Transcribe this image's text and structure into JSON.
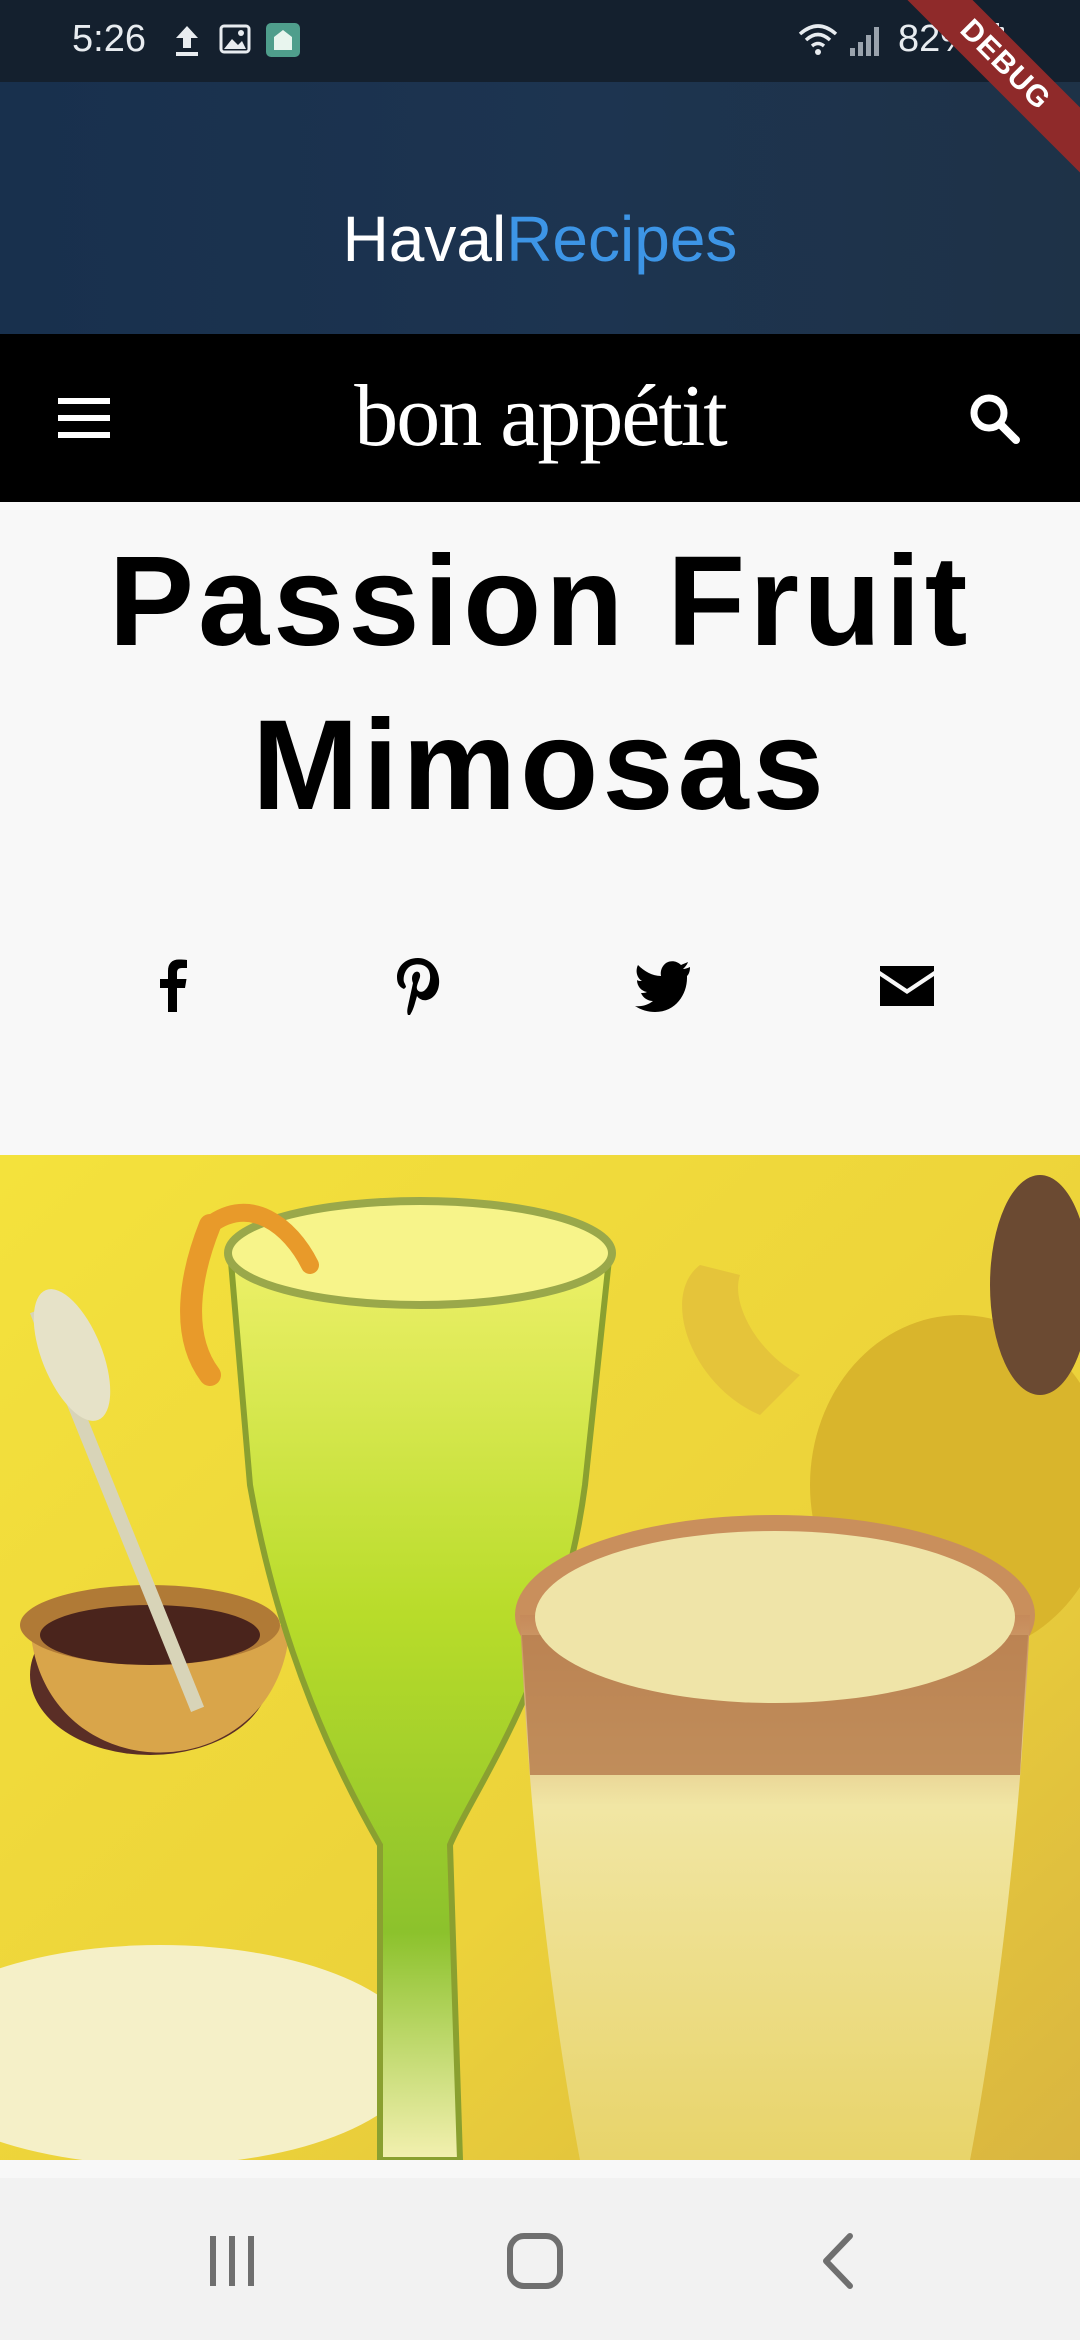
{
  "status_bar": {
    "time": "5:26",
    "battery": "82%"
  },
  "header": {
    "title_part1": "Haval",
    "title_part2": "Recipes",
    "debug_label": "DEBUG"
  },
  "nav": {
    "brand": "bon appétit"
  },
  "recipe": {
    "title_line1": "Passion Fruit",
    "title_line2": "Mimosas"
  },
  "share": {
    "icons": [
      "facebook-icon",
      "pinterest-icon",
      "twitter-icon",
      "email-icon"
    ]
  },
  "colors": {
    "header_bg": "#18304d",
    "accent": "#3d95e6",
    "nav_bg": "#000000",
    "debug_ribbon": "#8f2a2a"
  }
}
